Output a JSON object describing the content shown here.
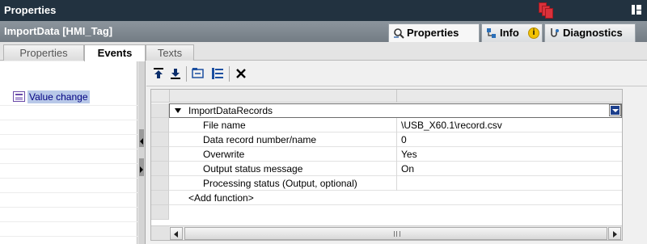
{
  "window": {
    "title": "Properties"
  },
  "header": {
    "object_name": "ImportData [HMI_Tag]",
    "tabs": [
      {
        "label": "Properties",
        "icon": "properties-icon",
        "active": true
      },
      {
        "label": "Info",
        "icon": "info-icon",
        "badge": "i"
      },
      {
        "label": "Diagnostics",
        "icon": "diagnostics-icon"
      }
    ]
  },
  "subtabs": [
    {
      "label": "Properties"
    },
    {
      "label": "Events",
      "active": true
    },
    {
      "label": "Texts"
    }
  ],
  "events": {
    "items": [
      {
        "label": "Value change",
        "icon": "event-icon",
        "selected": true
      }
    ]
  },
  "toolbar": {
    "buttons": [
      {
        "name": "move-up-icon"
      },
      {
        "name": "move-down-icon"
      },
      {
        "name": "group-icon"
      },
      {
        "name": "list-icon"
      },
      {
        "name": "delete-icon"
      }
    ]
  },
  "function_list": {
    "function_name": "ImportDataRecords",
    "parameters": [
      {
        "name": "File name",
        "value": "\\USB_X60.1\\record.csv"
      },
      {
        "name": "Data record number/name",
        "value": "0"
      },
      {
        "name": "Overwrite",
        "value": "Yes"
      },
      {
        "name": "Output status message",
        "value": "On"
      },
      {
        "name": "Processing status (Output, optional)",
        "value": ""
      }
    ],
    "add_function": "<Add function>"
  },
  "colors": {
    "titlebar": "#223240",
    "selection": "#b8c8e8",
    "accent": "#1c3f8c"
  }
}
